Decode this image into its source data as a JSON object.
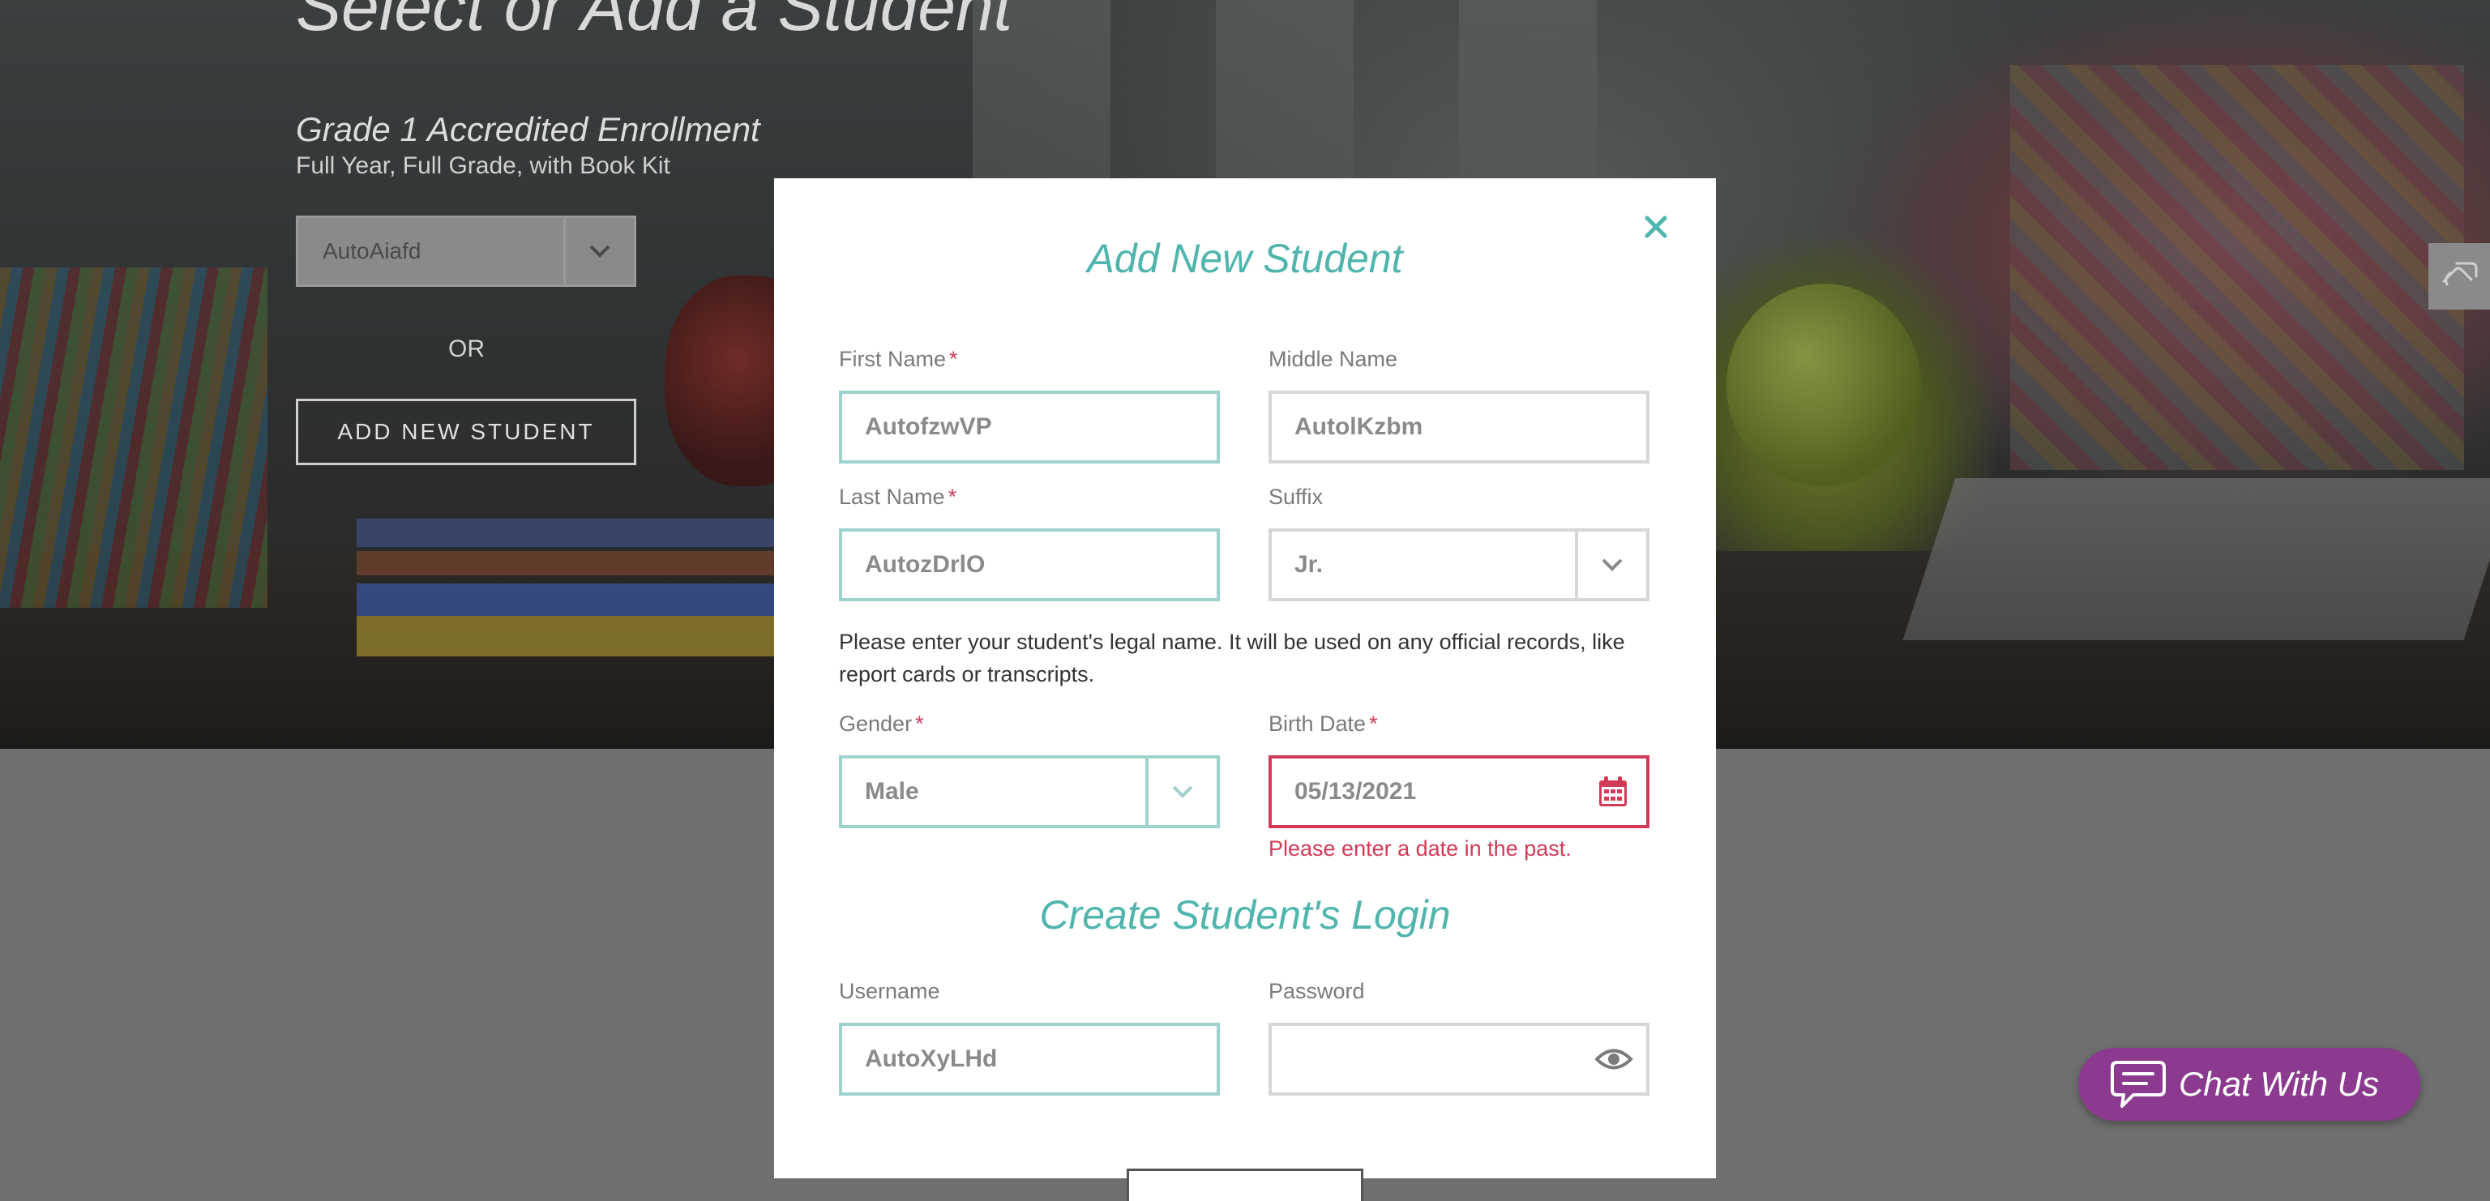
{
  "page": {
    "title": "Select or Add a Student",
    "enrollment_title": "Grade 1 Accredited Enrollment",
    "enrollment_subtitle": "Full Year, Full Grade, with Book Kit",
    "student_select_value": "AutoAiafd",
    "or_text": "OR",
    "add_new_button": "ADD NEW STUDENT"
  },
  "modal": {
    "title": "Add New Student",
    "first_name": {
      "label": "First Name",
      "required": "*",
      "value": "AutofzwVP"
    },
    "middle_name": {
      "label": "Middle Name",
      "value": "AutolKzbm"
    },
    "last_name": {
      "label": "Last Name",
      "required": "*",
      "value": "AutozDrlO"
    },
    "suffix": {
      "label": "Suffix",
      "value": "Jr."
    },
    "help_text": "Please enter your student's legal name. It will be used on any official records, like report cards or transcripts.",
    "gender": {
      "label": "Gender",
      "required": "*",
      "value": "Male"
    },
    "birth_date": {
      "label": "Birth Date",
      "required": "*",
      "value": "05/13/2021",
      "error": "Please enter a date in the past."
    },
    "login_title": "Create Student's Login",
    "username": {
      "label": "Username",
      "value": "AutoXyLHd"
    },
    "password": {
      "label": "Password",
      "value": ""
    }
  },
  "chat": {
    "label": "Chat With Us"
  },
  "icons": {
    "close": "close-icon",
    "chevron": "chevron-down-icon",
    "calendar": "calendar-icon",
    "eye": "eye-icon",
    "chat": "chat-bubble-icon",
    "side_tab": "hand-tool-icon"
  },
  "colors": {
    "accent": "#4fb5ad",
    "error": "#d33a57",
    "chat": "#8b3a8f"
  }
}
